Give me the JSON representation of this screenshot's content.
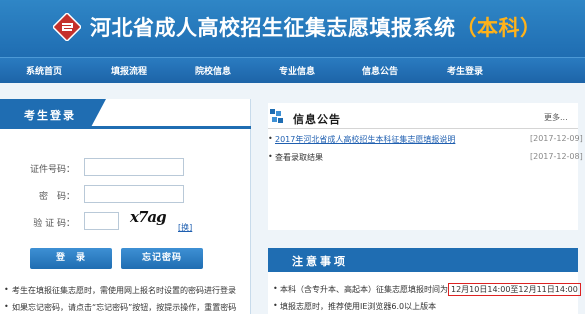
{
  "header": {
    "title": "河北省成人高校招生征集志愿填报系统",
    "suffix": "（本科）"
  },
  "nav": [
    "系统首页",
    "填报流程",
    "院校信息",
    "专业信息",
    "信息公告",
    "考生登录"
  ],
  "login": {
    "tab": "考生登录",
    "id_label": "证件号码：",
    "password_label": "密　码：",
    "captcha_label": "验 证 码：",
    "captcha_text": "x7ag",
    "change": "[换]",
    "login_btn": "登　录",
    "forgot_btn": "忘记密码",
    "tips": [
      "考生在填报征集志愿时，需使用网上报名时设置的密码进行登录",
      "如果忘记密码，请点击“忘记密码”按钮，按提示操作，重置密码"
    ]
  },
  "notice": {
    "title": "信息公告",
    "more": "更多...",
    "items": [
      {
        "text": "2017年河北省成人高校招生本科征集志愿填报说明",
        "date": "[2017-12-09]"
      },
      {
        "text": "查看录取结果",
        "date": "[2017-12-08]"
      }
    ]
  },
  "attention": {
    "title": "注意事项",
    "line1_prefix": "本科（含专升本、高起本）征集志愿填报时间为",
    "line1_time": "12月10日14:00至12月11日14:00",
    "line2": "填报志愿时，推荐使用IE浏览器6.0以上版本"
  },
  "colors": {
    "primary": "#1f6db2",
    "accent": "#ffb21a",
    "highlight": "#dd2222"
  }
}
